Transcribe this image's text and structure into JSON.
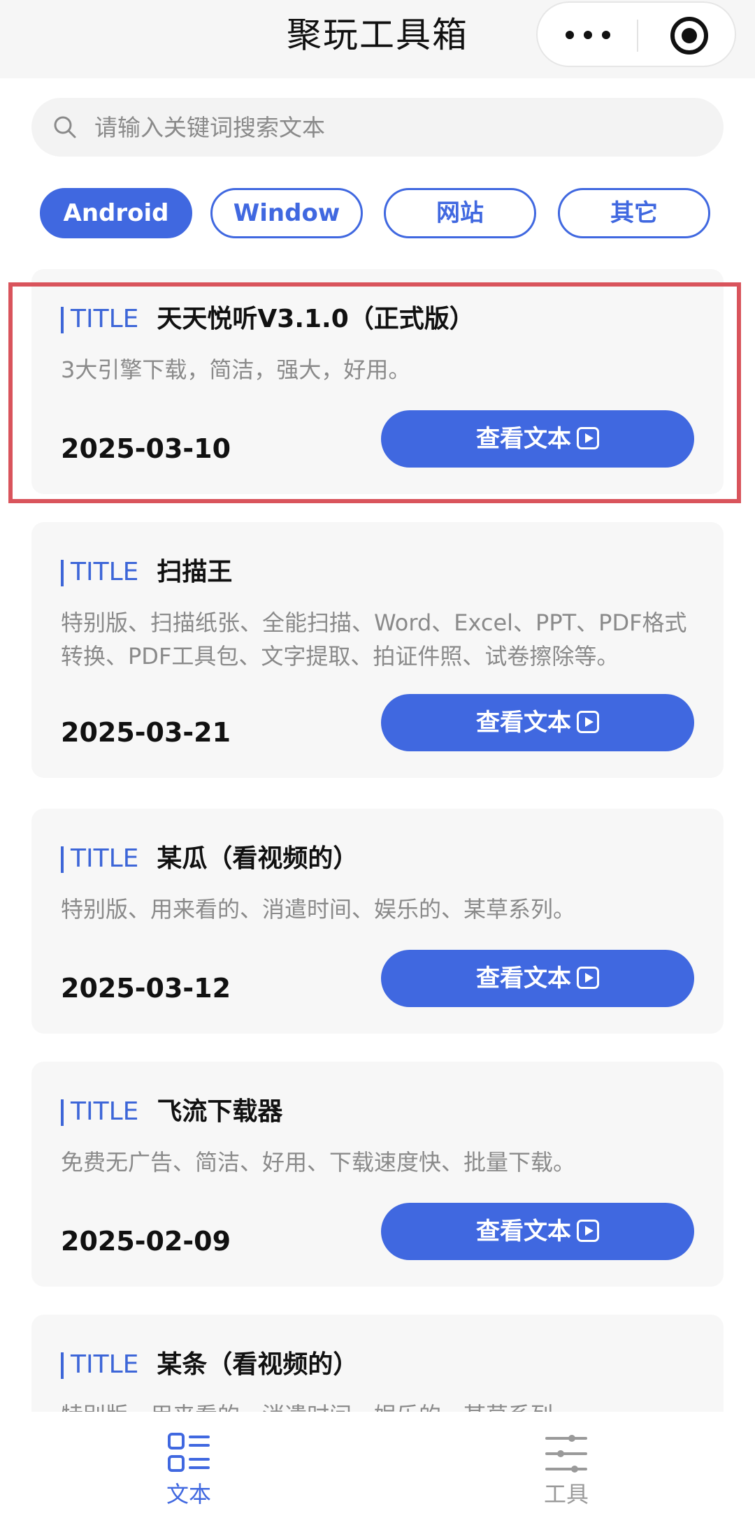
{
  "header": {
    "title": "聚玩工具箱"
  },
  "search": {
    "placeholder": "请输入关键词搜索文本"
  },
  "categories": [
    {
      "label": "Android",
      "active": true
    },
    {
      "label": "Window",
      "active": false
    },
    {
      "label": "网站",
      "active": false
    },
    {
      "label": "其它",
      "active": false
    }
  ],
  "tag_label": "TITLE",
  "button_label": "查看文本",
  "items": [
    {
      "title": "天天悦听V3.1.0（正式版）",
      "description": "3大引擎下载，简洁，强大，好用。",
      "date": "2025-03-10"
    },
    {
      "title": "扫描王",
      "description": "特别版、扫描纸张、全能扫描、Word、Excel、PPT、PDF格式转换、PDF工具包、文字提取、拍证件照、试卷擦除等。",
      "date": "2025-03-21"
    },
    {
      "title": "某瓜（看视频的）",
      "description": "特别版、用来看的、消遣时间、娱乐的、某草系列。",
      "date": "2025-03-12"
    },
    {
      "title": "飞流下载器",
      "description": "免费无广告、简洁、好用、下载速度快、批量下载。",
      "date": "2025-02-09"
    },
    {
      "title": "某条（看视频的）",
      "description": "特别版、用来看的、消遣时间、娱乐的、某草系列。",
      "date": ""
    }
  ],
  "tabbar": {
    "items": [
      {
        "label": "文本",
        "icon": "list-icon",
        "active": true
      },
      {
        "label": "工具",
        "icon": "sliders-icon",
        "active": false
      }
    ]
  },
  "colors": {
    "accent": "#4068e0",
    "highlight": "#d9545c",
    "muted": "#8a8a8a"
  }
}
